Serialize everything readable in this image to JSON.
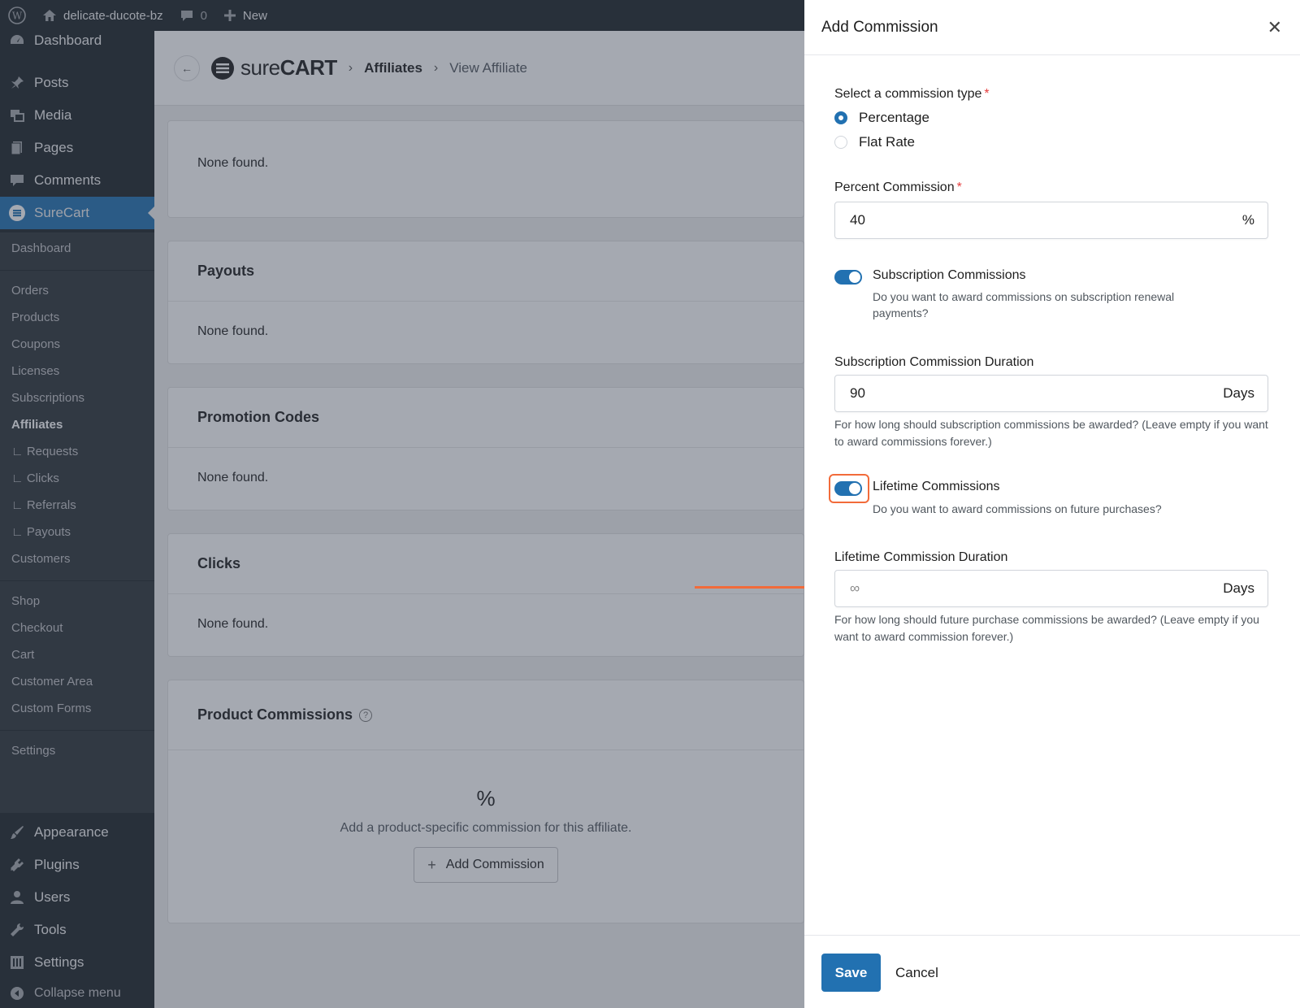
{
  "adminbar": {
    "site_name": "delicate-ducote-bz",
    "comments_count": "0",
    "new_label": "New"
  },
  "sidebar": {
    "top_items": [
      {
        "label": "Dashboard",
        "icon": "dashboard-icon"
      },
      {
        "label": "Posts",
        "icon": "pin-icon"
      },
      {
        "label": "Media",
        "icon": "media-icon"
      },
      {
        "label": "Pages",
        "icon": "pages-icon"
      },
      {
        "label": "Comments",
        "icon": "comment-icon"
      },
      {
        "label": "SureCart",
        "icon": "surecart-icon"
      }
    ],
    "submenu": [
      "Dashboard",
      "Orders",
      "Products",
      "Coupons",
      "Licenses",
      "Subscriptions",
      "Affiliates",
      "∟ Requests",
      "∟ Clicks",
      "∟ Referrals",
      "∟ Payouts",
      "Customers",
      "Shop",
      "Checkout",
      "Cart",
      "Customer Area",
      "Custom Forms",
      "Settings"
    ],
    "bottom_items": [
      {
        "label": "Appearance",
        "icon": "brush-icon"
      },
      {
        "label": "Plugins",
        "icon": "plugin-icon"
      },
      {
        "label": "Users",
        "icon": "users-icon"
      },
      {
        "label": "Tools",
        "icon": "wrench-icon"
      },
      {
        "label": "Settings",
        "icon": "settings-icon"
      },
      {
        "label": "Collapse menu",
        "icon": "collapse-icon"
      }
    ]
  },
  "header": {
    "logo_light": "sure",
    "logo_bold": "CART",
    "breadcrumb": [
      "Affiliates",
      "View Affiliate"
    ]
  },
  "main": {
    "none_found": "None found.",
    "sections": [
      "Payouts",
      "Promotion Codes",
      "Clicks",
      "Product Commissions"
    ],
    "help_glyph": "?",
    "empty_icon": "%",
    "empty_text": "Add a product-specific commission for this affiliate.",
    "add_commission_label": "Add Commission"
  },
  "drawer": {
    "title": "Add Commission",
    "commission_type_label": "Select a commission type",
    "options": [
      "Percentage",
      "Flat Rate"
    ],
    "selected_option": "Percentage",
    "percent_label": "Percent Commission",
    "percent_value": "40",
    "percent_suffix": "%",
    "sub_toggle_title": "Subscription Commissions",
    "sub_toggle_desc": "Do you want to award commissions on subscription renewal payments?",
    "sub_duration_label": "Subscription Commission Duration",
    "sub_duration_value": "90",
    "days_suffix": "Days",
    "sub_duration_help": "For how long should subscription commissions be awarded? (Leave empty if you want to award commissions forever.)",
    "life_toggle_title": "Lifetime Commissions",
    "life_toggle_desc": "Do you want to award commissions on future purchases?",
    "life_duration_label": "Lifetime Commission Duration",
    "life_duration_placeholder": "∞",
    "life_duration_help": "For how long should future purchase commissions be awarded? (Leave empty if you want to award commission forever.)",
    "save_label": "Save",
    "cancel_label": "Cancel"
  },
  "colors": {
    "accent": "#2271b1",
    "annotation": "#f26b3a",
    "admin_dark": "#1d2327"
  }
}
